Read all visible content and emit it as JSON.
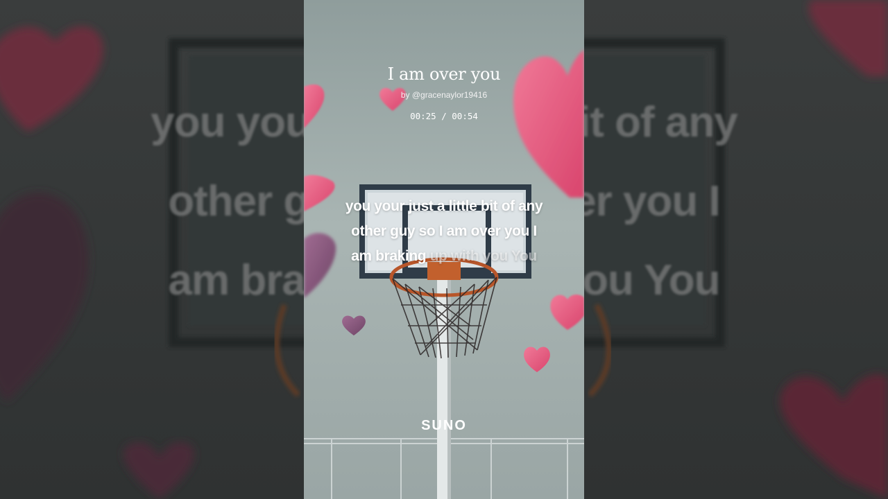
{
  "song": {
    "title": "I am over you",
    "artist": "by @gracenaylor19416",
    "time_display": "00:25 / 00:54"
  },
  "lyrics": {
    "lines": [
      "you your just a little bit of any",
      "other guy so I am over you I",
      "am braking"
    ],
    "pending": "up with you You",
    "background_lines": [
      "you your just a little bit of any",
      "other guy so I am over you I",
      "am braking up with you You"
    ]
  },
  "brand": {
    "logo_text": "SUNO"
  },
  "colors": {
    "heart_pink": "#e45a80",
    "heart_purple": "#8a5a7c",
    "sky": "#a3b0af",
    "rim_orange": "#b8562a"
  },
  "icons": [
    "heart-icon",
    "basketball-hoop-illustration"
  ]
}
